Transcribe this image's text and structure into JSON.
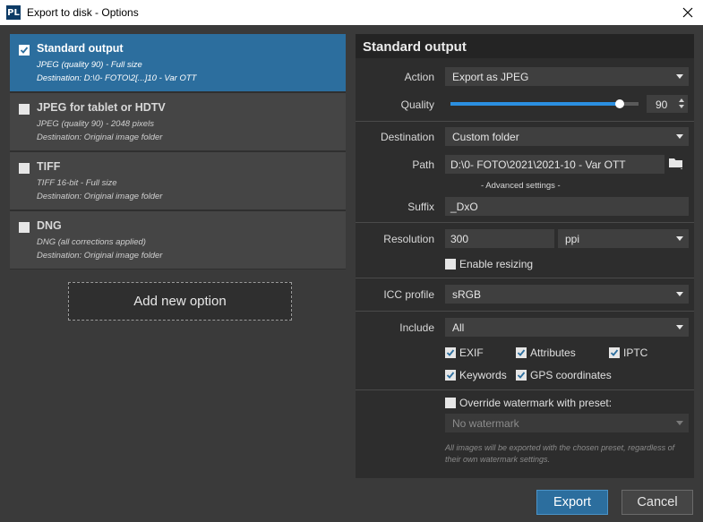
{
  "window": {
    "title": "Export to disk - Options",
    "logo": "PL"
  },
  "options": [
    {
      "name": "Standard output",
      "line1": "JPEG (quality 90) - Full size",
      "line2": "Destination: D:\\0- FOTO\\2[...]10 - Var OTT",
      "checked": true
    },
    {
      "name": "JPEG for tablet or HDTV",
      "line1": "JPEG (quality 90) - 2048 pixels",
      "line2": "Destination: Original image folder",
      "checked": false
    },
    {
      "name": "TIFF",
      "line1": "TIFF 16-bit - Full size",
      "line2": "Destination: Original image folder",
      "checked": false
    },
    {
      "name": "DNG",
      "line1": "DNG (all corrections applied)",
      "line2": "Destination: Original image folder",
      "checked": false
    }
  ],
  "add_option_label": "Add new option",
  "settings": {
    "header": "Standard output",
    "action": {
      "label": "Action",
      "value": "Export as JPEG"
    },
    "quality": {
      "label": "Quality",
      "value": "90",
      "fraction": 0.9
    },
    "destination": {
      "label": "Destination",
      "value": "Custom folder"
    },
    "path": {
      "label": "Path",
      "value": "D:\\0- FOTO\\2021\\2021-10 - Var OTT"
    },
    "advanced": "- Advanced settings -",
    "suffix": {
      "label": "Suffix",
      "value": "_DxO"
    },
    "resolution": {
      "label": "Resolution",
      "value": "300",
      "unit": "ppi"
    },
    "enable_resizing": {
      "label": "Enable resizing",
      "checked": false
    },
    "icc": {
      "label": "ICC profile",
      "value": "sRGB"
    },
    "include": {
      "label": "Include",
      "value": "All",
      "exif": "EXIF",
      "attributes": "Attributes",
      "iptc": "IPTC",
      "keywords": "Keywords",
      "gps": "GPS coordinates"
    },
    "watermark": {
      "override_label": "Override watermark with preset:",
      "value": "No watermark",
      "note": "All images will be exported with the chosen preset, regardless of their own watermark settings."
    }
  },
  "buttons": {
    "export": "Export",
    "cancel": "Cancel"
  },
  "colors": {
    "accent": "#2c6e9e",
    "slider": "#2b8fe0"
  },
  "icons": [
    "app-logo-icon",
    "close-icon",
    "checkbox-icon",
    "chevron-down-icon",
    "folder-icon",
    "spin-up-icon",
    "spin-down-icon"
  ]
}
